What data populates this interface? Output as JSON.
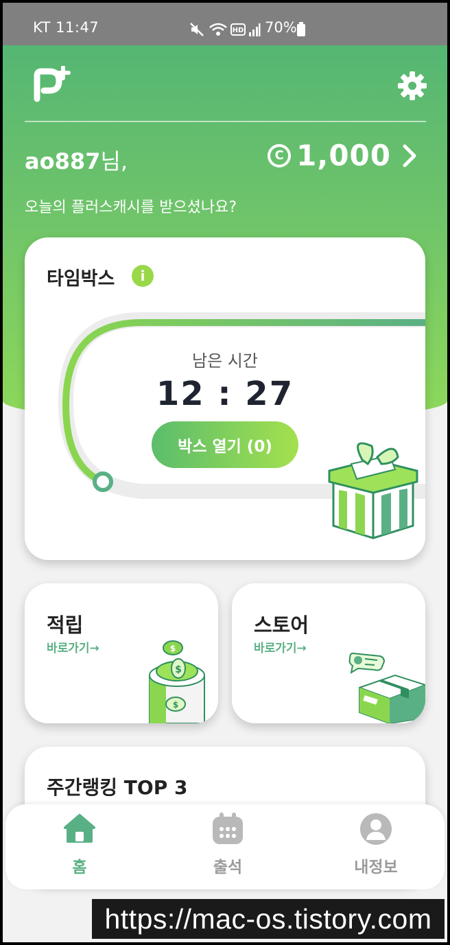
{
  "status_bar": {
    "carrier_time": "KT 11:47",
    "battery": "70%"
  },
  "header": {
    "username": "ao887",
    "username_suffix": "님,",
    "balance": "1,000",
    "coin_symbol": "C",
    "greeting": "오늘의 플러스캐시를 받으셨나요?"
  },
  "timebox": {
    "title": "타임박스",
    "info_symbol": "i",
    "remaining_label": "남은 시간",
    "remaining_time": "12 : 27",
    "open_button": "박스 열기 (0)"
  },
  "cards": {
    "earn": {
      "title": "적립",
      "link": "바로가기→"
    },
    "store": {
      "title": "스토어",
      "link": "바로가기→"
    }
  },
  "ranking": {
    "title": "주간랭킹 TOP 3"
  },
  "bottom_nav": {
    "home": "홈",
    "attendance": "출석",
    "my_info": "내정보"
  },
  "watermark": "https://mac-os.tistory.com",
  "colors": {
    "brand_green": "#5ab085",
    "light_green": "#9ad84a",
    "inactive_gray": "#9a9a9a"
  }
}
